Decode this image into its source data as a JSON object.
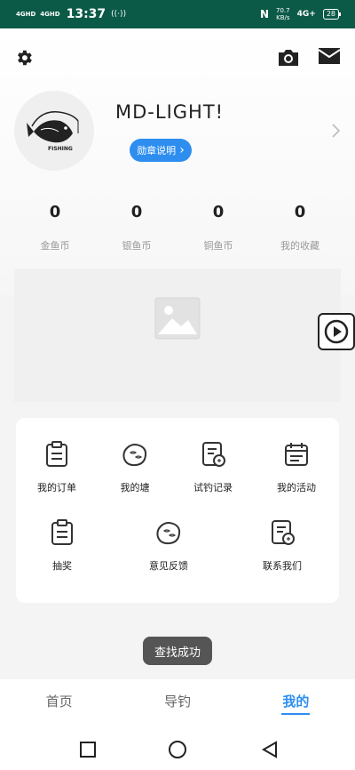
{
  "status_bar": {
    "signal1": "4GHD",
    "signal2": "4GHD",
    "time": "13:37",
    "hotspot": "((·))",
    "nfc": "N",
    "speed_value": "70.7",
    "speed_unit": "KB/s",
    "network": "4G+",
    "battery": "28"
  },
  "header": {
    "settings_icon": "gear-icon",
    "camera_icon": "camera-icon",
    "mail_icon": "mail-icon"
  },
  "profile": {
    "avatar_text": "FISHING",
    "username": "MD-LIGHT!",
    "badge_label": "勋章说明",
    "badge_chevron": "›"
  },
  "stats": [
    {
      "value": "0",
      "label": "金鱼币"
    },
    {
      "value": "0",
      "label": "银鱼币"
    },
    {
      "value": "0",
      "label": "铜鱼币"
    },
    {
      "value": "0",
      "label": "我的收藏"
    }
  ],
  "menu": {
    "row1": [
      {
        "label": "我的订单",
        "icon": "clipboard-icon"
      },
      {
        "label": "我的塘",
        "icon": "pond-icon"
      },
      {
        "label": "试钓记录",
        "icon": "record-icon"
      },
      {
        "label": "我的活动",
        "icon": "calendar-icon"
      }
    ],
    "row2": [
      {
        "label": "抽奖",
        "icon": "clipboard-icon"
      },
      {
        "label": "意见反馈",
        "icon": "pond-icon"
      },
      {
        "label": "联系我们",
        "icon": "record-icon"
      }
    ]
  },
  "toast": "查找成功",
  "tabs": [
    {
      "label": "首页"
    },
    {
      "label": "导钓"
    },
    {
      "label": "我的"
    }
  ],
  "colors": {
    "status_bar": "#0b5a47",
    "accent": "#2d8ef0",
    "toast_bg": "#555555"
  }
}
